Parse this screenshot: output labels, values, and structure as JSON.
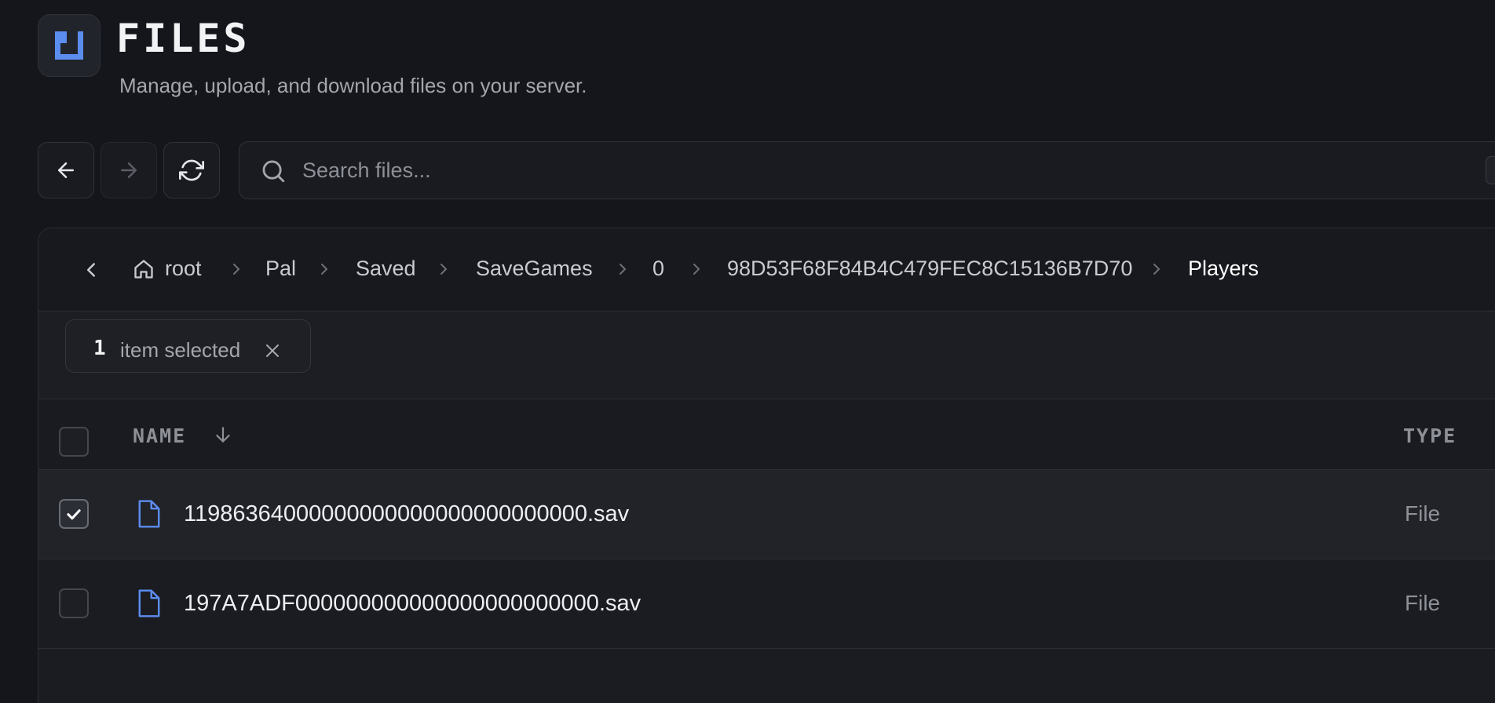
{
  "header": {
    "title": "FILES",
    "subtitle": "Manage, upload, and download files on your server.",
    "icon": "folder-icon",
    "accent_color": "#5b8def"
  },
  "toolbar": {
    "back_icon": "arrow-left-icon",
    "forward_icon": "arrow-right-icon",
    "refresh_icon": "refresh-icon",
    "search": {
      "placeholder": "Search files...",
      "value": ""
    }
  },
  "breadcrumb": {
    "back_icon": "chevron-left-icon",
    "home_icon": "home-icon",
    "items": [
      {
        "label": "root"
      },
      {
        "label": "Pal"
      },
      {
        "label": "Saved"
      },
      {
        "label": "SaveGames"
      },
      {
        "label": "0"
      },
      {
        "label": "98D53F68F84B4C479FEC8C15136B7D70"
      },
      {
        "label": "Players"
      }
    ]
  },
  "selection": {
    "count": "1",
    "label": "item selected"
  },
  "table": {
    "columns": {
      "name": "NAME",
      "type": "TYPE"
    },
    "sort": {
      "column": "NAME",
      "direction": "descending"
    },
    "rows": [
      {
        "name": "11986364000000000000000000000000.sav",
        "type": "File",
        "selected": true
      },
      {
        "name": "197A7ADF000000000000000000000000.sav",
        "type": "File",
        "selected": false
      }
    ]
  }
}
